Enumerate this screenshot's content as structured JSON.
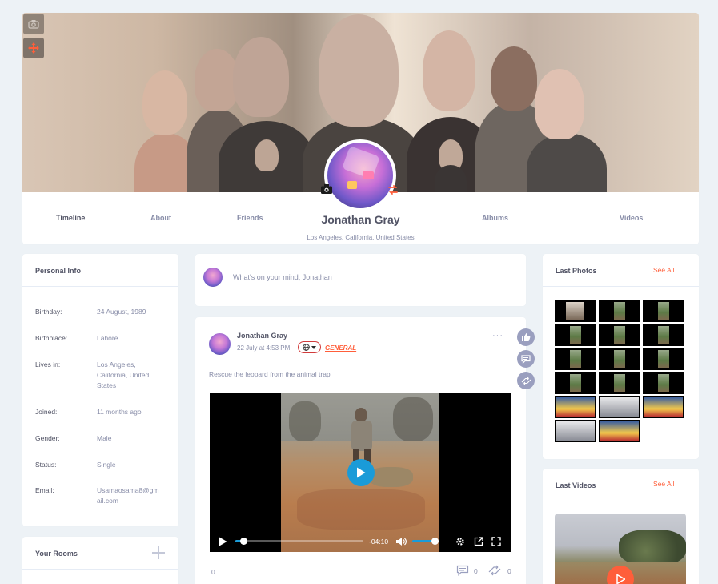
{
  "profile": {
    "name": "Jonathan Gray",
    "location": "Los Angeles, California, United States",
    "nav": {
      "timeline": "Timeline",
      "about": "About",
      "friends": "Friends",
      "albums": "Albums",
      "videos": "Videos"
    }
  },
  "personal_info": {
    "title": "Personal Info",
    "rows": [
      {
        "label": "Birthday:",
        "value": "24 August, 1989"
      },
      {
        "label": "Birthplace:",
        "value": "Lahore"
      },
      {
        "label": "Lives in:",
        "value": "Los Angeles, California, United States"
      },
      {
        "label": "Joined:",
        "value": "11 months ago"
      },
      {
        "label": "Gender:",
        "value": "Male"
      },
      {
        "label": "Status:",
        "value": "Single"
      },
      {
        "label": "Email:",
        "value": "Usamaosama8@gmail.com"
      }
    ]
  },
  "rooms": {
    "title": "Your Rooms"
  },
  "status_box": {
    "placeholder": "What's on your mind, Jonathan"
  },
  "post": {
    "author": "Jonathan Gray",
    "time": "22 July at 4:53 PM",
    "tag": "GENERAL",
    "more": "···",
    "text": "Rescue the leopard from the animal trap",
    "video": {
      "time_remaining": "-04:10",
      "progress": 0.06,
      "volume": 0.85
    },
    "likes": "0",
    "comments": "0",
    "shares": "0"
  },
  "last_photos": {
    "title": "Last Photos",
    "see_all": "See All",
    "count": 17
  },
  "last_videos": {
    "title": "Last Videos",
    "see_all": "See All"
  },
  "colors": {
    "accent": "#ff5e3a",
    "video_blue": "#1a9bd8",
    "text_dark": "#515365",
    "text_muted": "#888da8",
    "background": "#edf2f6"
  }
}
